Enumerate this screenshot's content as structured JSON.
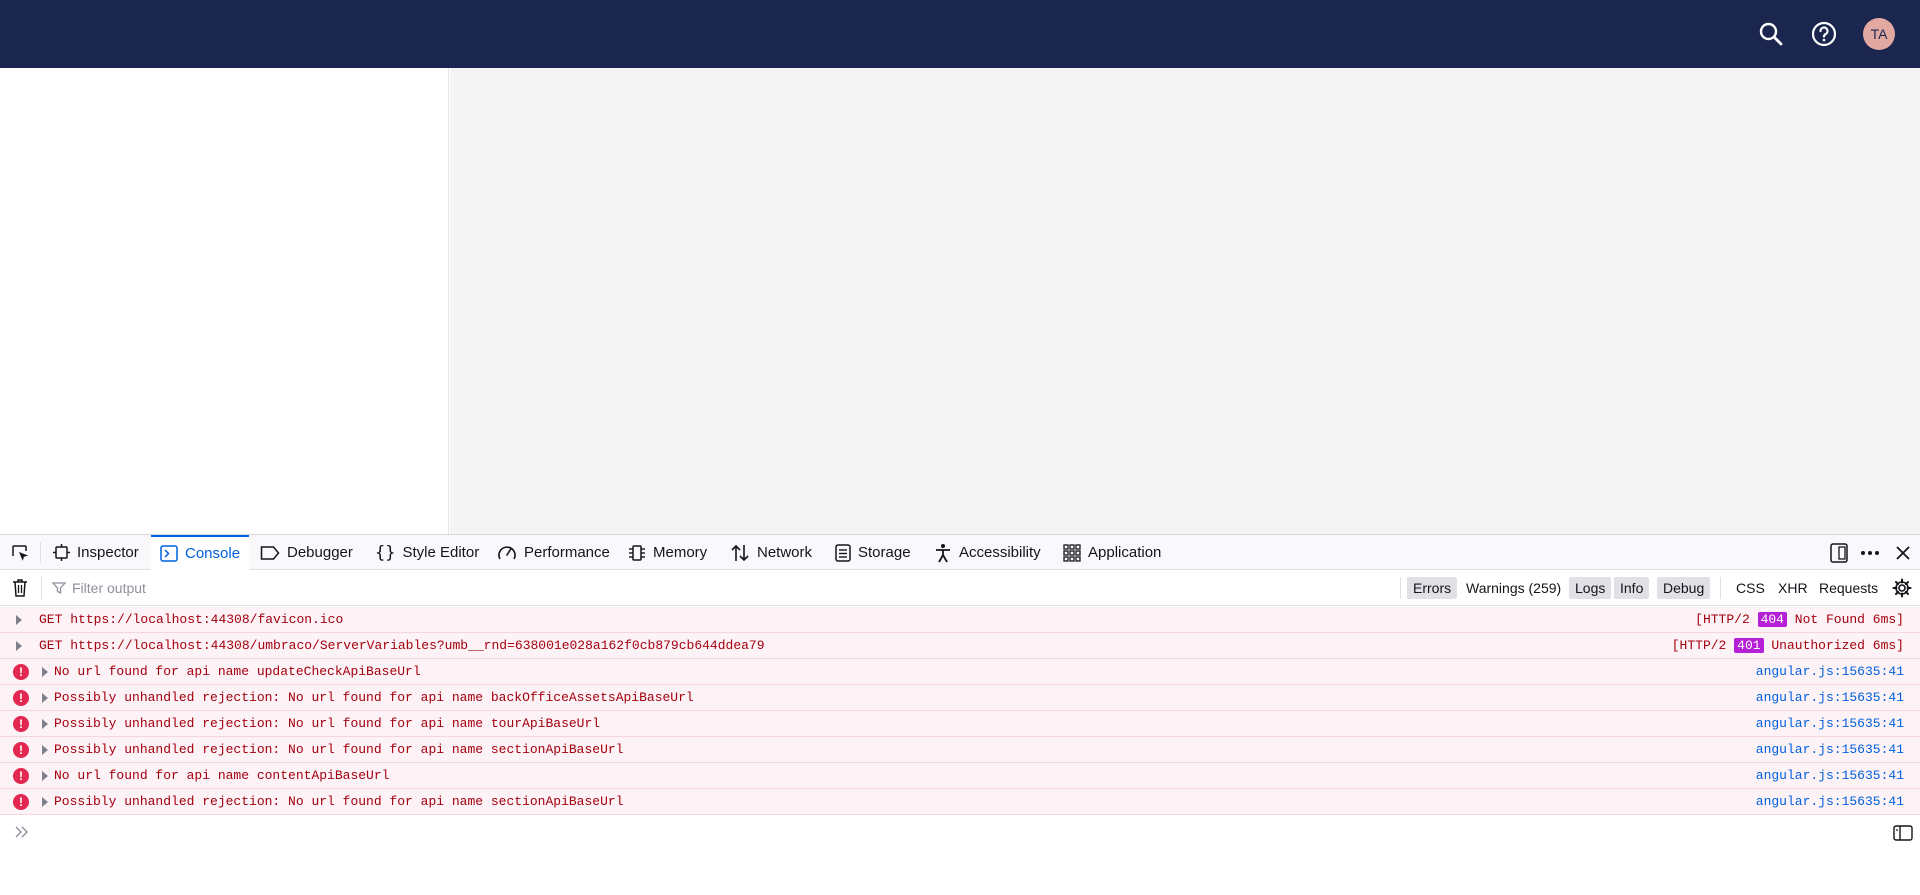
{
  "header": {
    "avatar_initials": "TA",
    "icons": [
      "search-icon",
      "help-icon"
    ],
    "background": "#1b264f"
  },
  "devtools": {
    "tabs": [
      {
        "label": "Inspector",
        "icon": "inspector-icon"
      },
      {
        "label": "Console",
        "icon": "console-icon",
        "active": true
      },
      {
        "label": "Debugger",
        "icon": "debugger-icon"
      },
      {
        "label": "Style Editor",
        "icon": "style-editor-icon"
      },
      {
        "label": "Performance",
        "icon": "performance-icon"
      },
      {
        "label": "Memory",
        "icon": "memory-icon"
      },
      {
        "label": "Network",
        "icon": "network-icon"
      },
      {
        "label": "Storage",
        "icon": "storage-icon"
      },
      {
        "label": "Accessibility",
        "icon": "accessibility-icon"
      },
      {
        "label": "Application",
        "icon": "application-icon"
      }
    ],
    "filter": {
      "placeholder": "Filter output",
      "levels": [
        {
          "label": "Errors",
          "on": true
        },
        {
          "label": "Warnings (259)",
          "on": false
        },
        {
          "label": "Logs",
          "on": true
        },
        {
          "label": "Info",
          "on": true
        },
        {
          "label": "Debug",
          "on": true
        }
      ],
      "net": [
        "CSS",
        "XHR",
        "Requests"
      ]
    },
    "messages": [
      {
        "type": "net",
        "method": "GET",
        "url": "https://localhost:44308/favicon.ico",
        "status_prefix": "[HTTP/2 ",
        "code": "404",
        "status_suffix": " Not Found 6ms]"
      },
      {
        "type": "net",
        "method": "GET",
        "url": "https://localhost:44308/umbraco/ServerVariables?umb__rnd=638001e028a162f0cb879cb644ddea79",
        "status_prefix": "[HTTP/2 ",
        "code": "401",
        "status_suffix": " Unauthorized 6ms]"
      },
      {
        "type": "error",
        "text": "No url found for api name updateCheckApiBaseUrl",
        "source": "angular.js:15635:41"
      },
      {
        "type": "error",
        "text": "Possibly unhandled rejection: No url found for api name backOfficeAssetsApiBaseUrl",
        "source": "angular.js:15635:41"
      },
      {
        "type": "error",
        "text": "Possibly unhandled rejection: No url found for api name tourApiBaseUrl",
        "source": "angular.js:15635:41"
      },
      {
        "type": "error",
        "text": "Possibly unhandled rejection: No url found for api name sectionApiBaseUrl",
        "source": "angular.js:15635:41"
      },
      {
        "type": "error",
        "text": "No url found for api name contentApiBaseUrl",
        "source": "angular.js:15635:41"
      },
      {
        "type": "error",
        "text": "Possibly unhandled rejection: No url found for api name sectionApiBaseUrl",
        "source": "angular.js:15635:41"
      }
    ]
  }
}
